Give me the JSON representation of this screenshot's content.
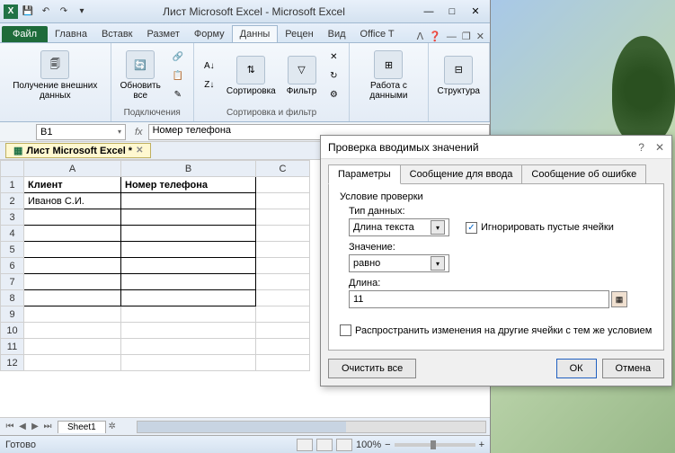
{
  "title": "Лист Microsoft Excel  -  Microsoft Excel",
  "tabs": {
    "file": "Файл",
    "home": "Главна",
    "insert": "Вставк",
    "layout": "Размет",
    "formulas": "Форму",
    "data": "Данны",
    "review": "Рецен",
    "view": "Вид",
    "office": "Office T"
  },
  "ribbon": {
    "external": "Получение внешних данных",
    "refresh": "Обновить все",
    "connections": "Подключения",
    "sort": "Сортировка",
    "filter": "Фильтр",
    "sort_filter": "Сортировка и фильтр",
    "data_tools": "Работа с данными",
    "outline": "Структура"
  },
  "name_box": "B1",
  "formula": "Номер телефона",
  "workbook_tab": "Лист Microsoft Excel *",
  "columns": [
    "A",
    "B",
    "C"
  ],
  "rows": [
    "1",
    "2",
    "3",
    "4",
    "5",
    "6",
    "7",
    "8",
    "9",
    "10",
    "11",
    "12"
  ],
  "cells": {
    "A1": "Клиент",
    "B1": "Номер телефона",
    "A2": "Иванов С.И."
  },
  "sheet_tab": "Sheet1",
  "status_text": "Готово",
  "zoom": "100%",
  "dialog": {
    "title": "Проверка вводимых значений",
    "tab_params": "Параметры",
    "tab_input": "Сообщение для ввода",
    "tab_error": "Сообщение об ошибке",
    "section": "Условие проверки",
    "type_label": "Тип данных:",
    "type_value": "Длина текста",
    "ignore_blank": "Игнорировать пустые ячейки",
    "value_label": "Значение:",
    "value_value": "равно",
    "length_label": "Длина:",
    "length_value": "11",
    "apply_all": "Распространить изменения на другие ячейки с тем же условием",
    "clear": "Очистить все",
    "ok": "ОК",
    "cancel": "Отмена"
  }
}
